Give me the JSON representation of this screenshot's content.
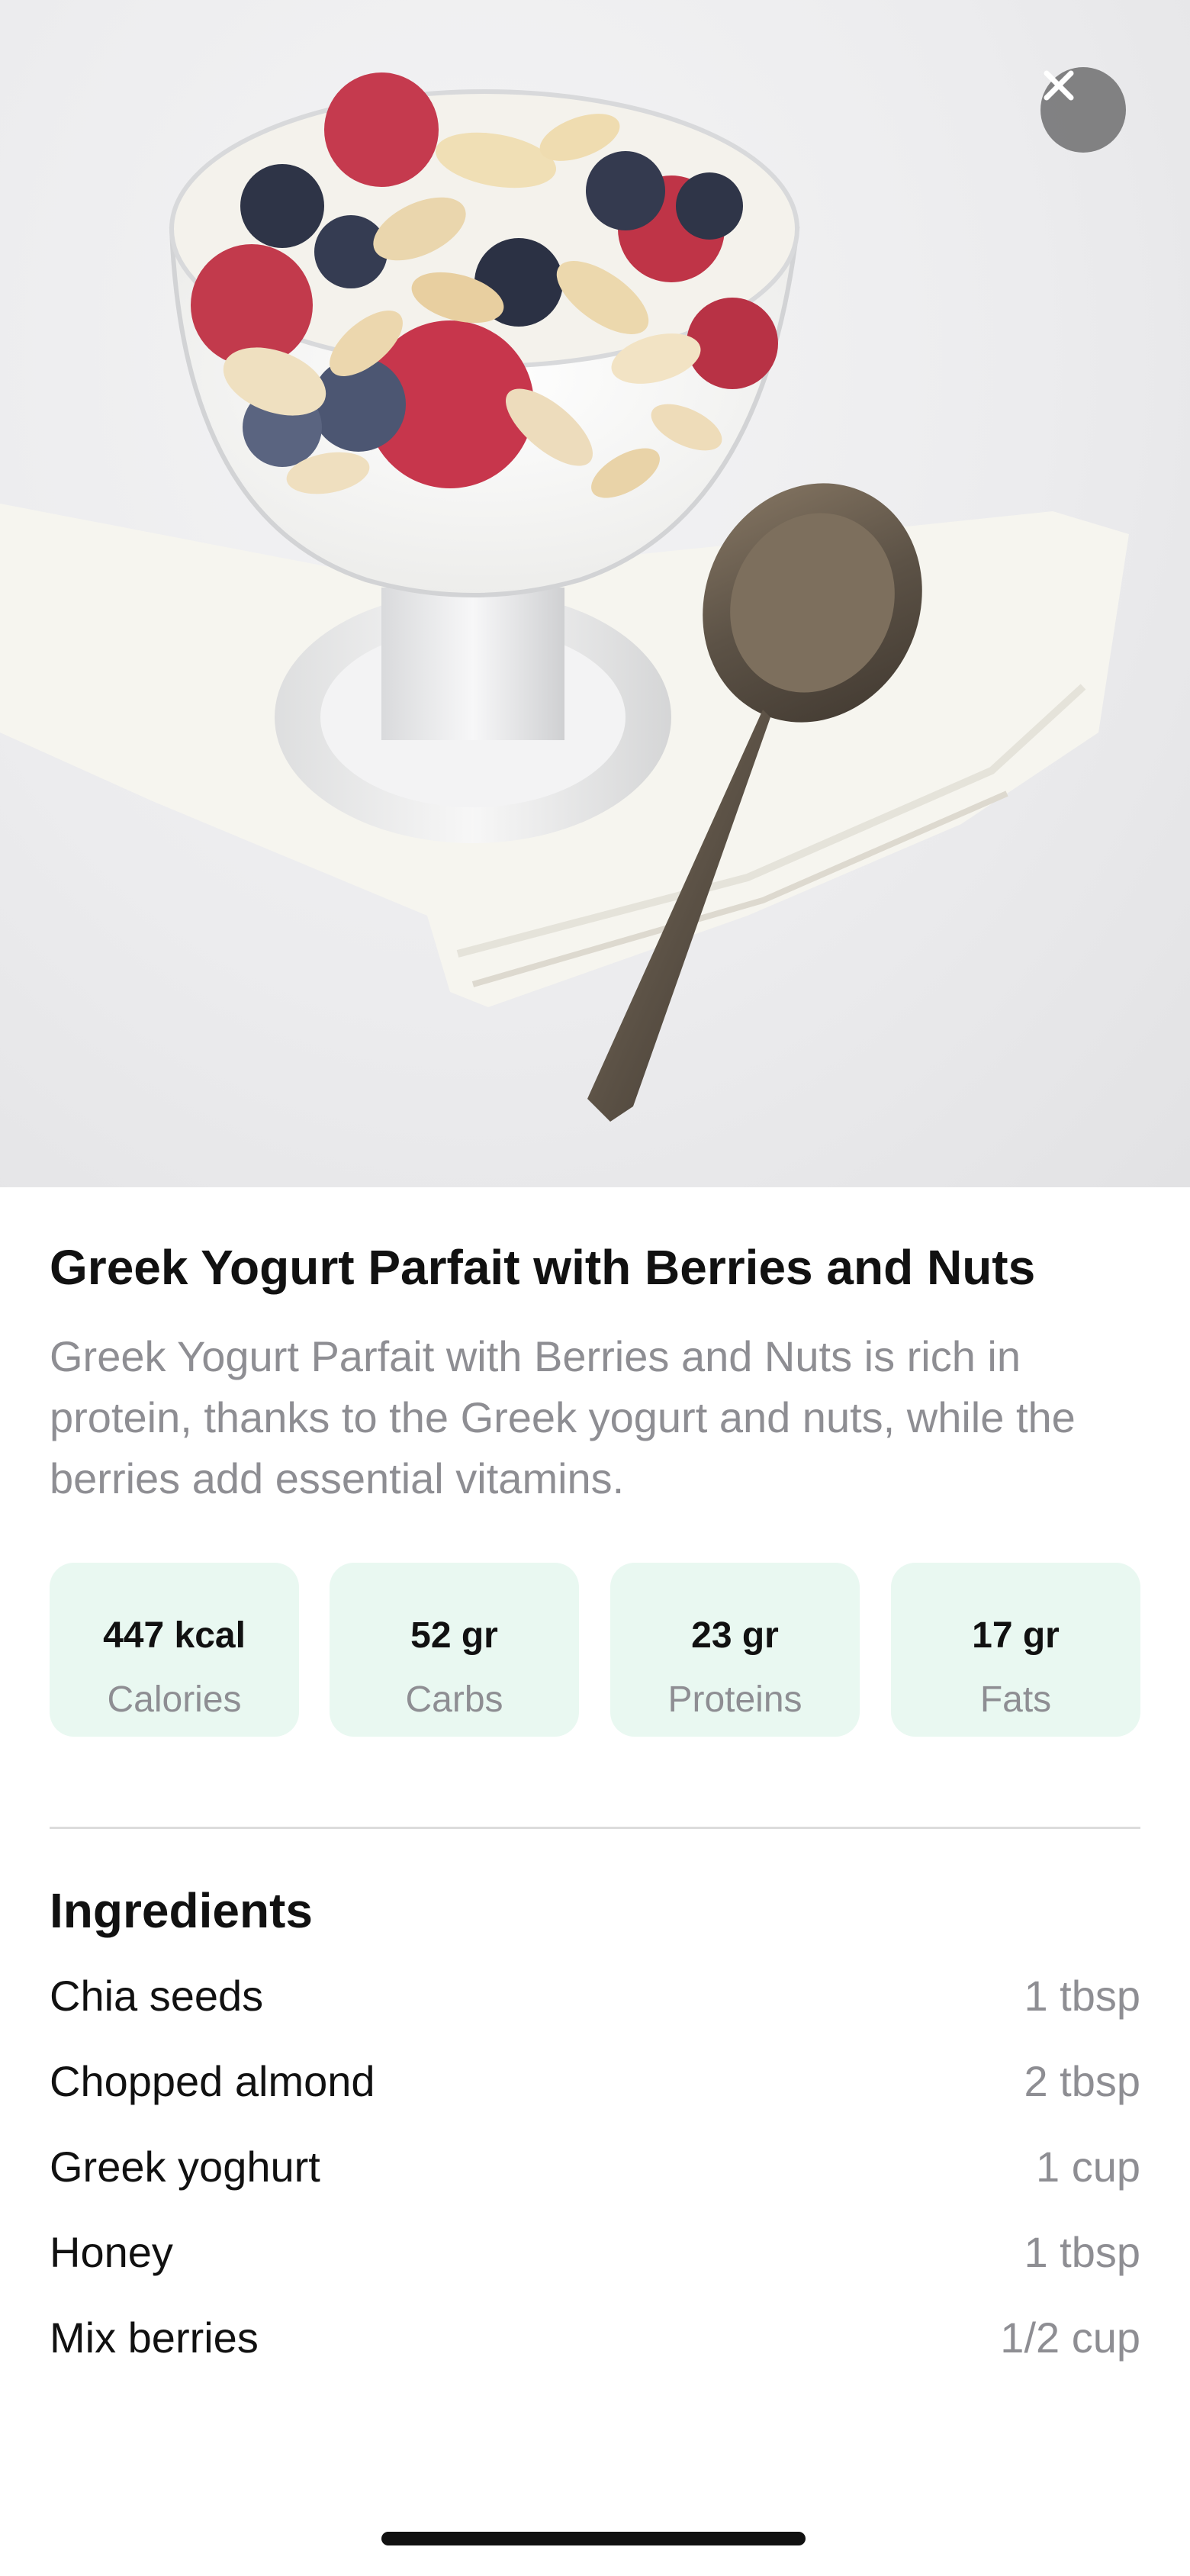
{
  "hero": {
    "image_name": "greek-yogurt-parfait-photo",
    "close_icon": "close-icon"
  },
  "recipe": {
    "title": "Greek Yogurt Parfait with Berries and Nuts",
    "description": "Greek Yogurt Parfait with Berries and Nuts is rich in protein, thanks to the Greek yogurt and nuts, while the berries add essential vitamins."
  },
  "nutrition": [
    {
      "value": "447 kcal",
      "label": "Calories"
    },
    {
      "value": "52 gr",
      "label": "Carbs"
    },
    {
      "value": "23 gr",
      "label": "Proteins"
    },
    {
      "value": "17 gr",
      "label": "Fats"
    }
  ],
  "ingredients": {
    "title": "Ingredients",
    "items": [
      {
        "name": "Chia seeds",
        "amount": "1 tbsp"
      },
      {
        "name": "Chopped almond",
        "amount": "2 tbsp"
      },
      {
        "name": "Greek yoghurt",
        "amount": "1 cup"
      },
      {
        "name": "Honey",
        "amount": "1 tbsp"
      },
      {
        "name": "Mix berries",
        "amount": "1/2 cup"
      }
    ]
  },
  "colors": {
    "stat_card_bg": "#e9f8f1",
    "primary_text": "#111111",
    "secondary_text": "#8e8e93"
  }
}
